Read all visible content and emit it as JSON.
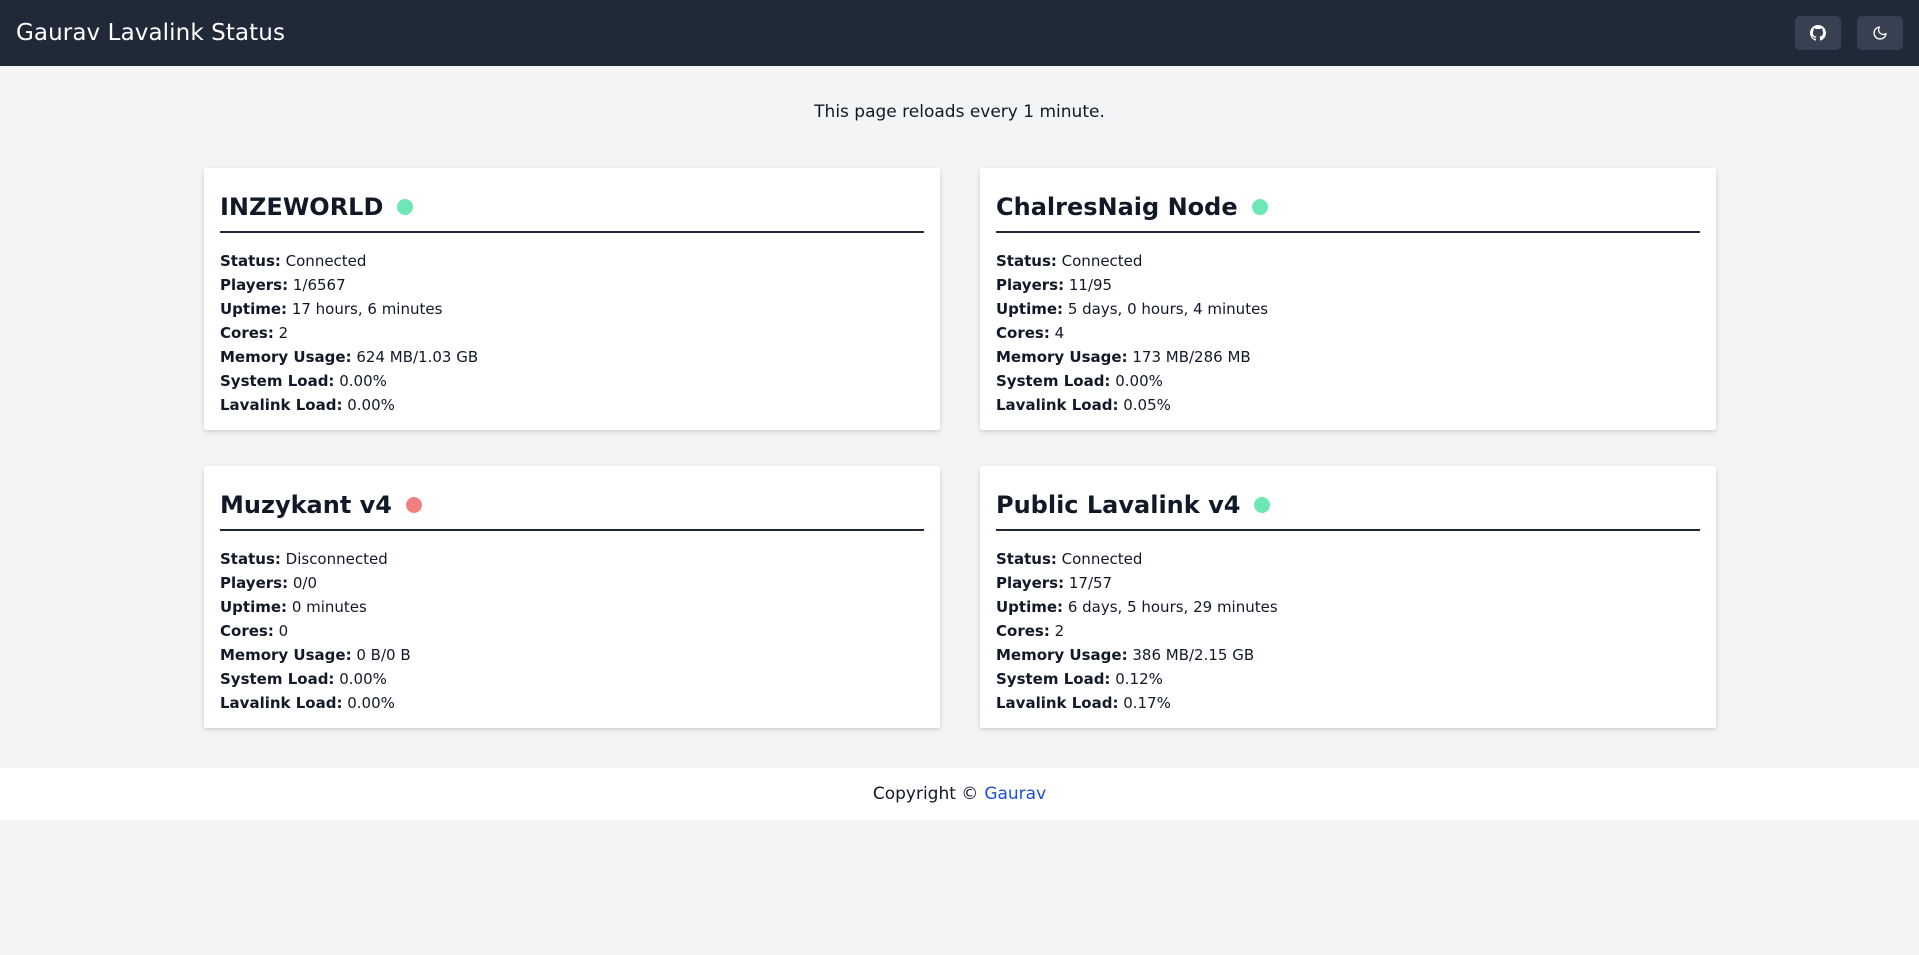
{
  "app": {
    "title": "Gaurav Lavalink Status"
  },
  "header": {
    "github_icon": "github-icon",
    "theme_icon": "moon-icon"
  },
  "notice": "This page reloads every 1 minute.",
  "labels": {
    "status": "Status:",
    "players": "Players:",
    "uptime": "Uptime:",
    "cores": "Cores:",
    "memory": "Memory Usage:",
    "system_load": "System Load:",
    "lavalink_load": "Lavalink Load:"
  },
  "colors": {
    "online": "#6ee7b7",
    "offline": "#f08080",
    "header_bg": "#1f2937",
    "link": "#1d4ed8"
  },
  "nodes": [
    {
      "name": "INZEWORLD",
      "online": true,
      "status": "Connected",
      "players": "1/6567",
      "uptime": "17 hours, 6 minutes",
      "cores": "2",
      "memory": "624 MB/1.03 GB",
      "system_load": "0.00%",
      "lavalink_load": "0.00%"
    },
    {
      "name": "ChalresNaig Node",
      "online": true,
      "status": "Connected",
      "players": "11/95",
      "uptime": "5 days, 0 hours, 4 minutes",
      "cores": "4",
      "memory": "173 MB/286 MB",
      "system_load": "0.00%",
      "lavalink_load": "0.05%"
    },
    {
      "name": "Muzykant v4",
      "online": false,
      "status": "Disconnected",
      "players": "0/0",
      "uptime": "0 minutes",
      "cores": "0",
      "memory": "0 B/0 B",
      "system_load": "0.00%",
      "lavalink_load": "0.00%"
    },
    {
      "name": "Public Lavalink v4",
      "online": true,
      "status": "Connected",
      "players": "17/57",
      "uptime": "6 days, 5 hours, 29 minutes",
      "cores": "2",
      "memory": "386 MB/2.15 GB",
      "system_load": "0.12%",
      "lavalink_load": "0.17%"
    }
  ],
  "footer": {
    "copyright": "Copyright ©",
    "author": "Gaurav"
  }
}
